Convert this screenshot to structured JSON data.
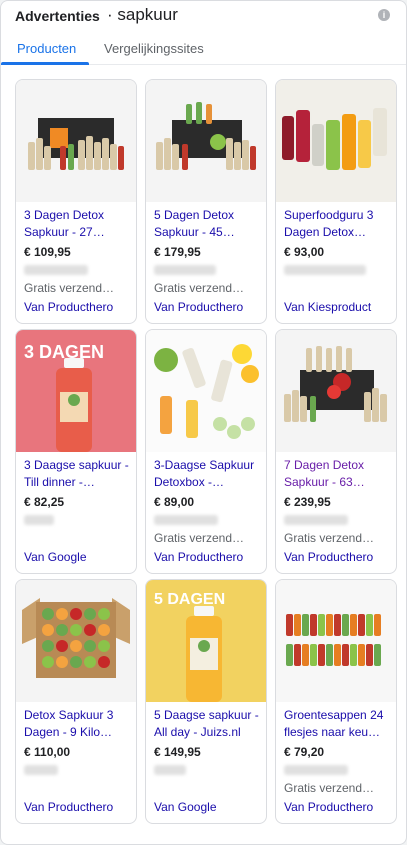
{
  "header": {
    "ads_label": "Advertenties",
    "query": "· sapkuur",
    "info_icon": "info-icon"
  },
  "tabs": [
    {
      "label": "Producten",
      "active": true
    },
    {
      "label": "Vergelijkingssites",
      "active": false
    }
  ],
  "products": [
    {
      "title": "3 Dagen Detox Sapkuur - 27…",
      "price": "€ 109,95",
      "shipping": "Gratis verzend…",
      "seller": "Van Producthero",
      "visited": false
    },
    {
      "title": "5 Dagen Detox Sapkuur - 45…",
      "price": "€ 179,95",
      "shipping": "Gratis verzend…",
      "seller": "Van Producthero",
      "visited": false
    },
    {
      "title": "Superfoodguru 3 Dagen Detox…",
      "price": "€ 93,00",
      "shipping": "",
      "seller": "Van Kiesproduct",
      "visited": false
    },
    {
      "title": "3 Daagse sapkuur - Till dinner -…",
      "price": "€ 82,25",
      "shipping": "",
      "seller": "Van Google",
      "visited": false
    },
    {
      "title": "3-Daagse Sapkuur Detoxbox -…",
      "price": "€ 89,00",
      "shipping": "Gratis verzend…",
      "seller": "Van Producthero",
      "visited": false
    },
    {
      "title": "7 Dagen Detox Sapkuur - 63…",
      "price": "€ 239,95",
      "shipping": "Gratis verzend…",
      "seller": "Van Producthero",
      "visited": true
    },
    {
      "title": "Detox Sapkuur 3 Dagen - 9 Kilo…",
      "price": "€ 110,00",
      "shipping": "",
      "seller": "Van Producthero",
      "visited": false
    },
    {
      "title": "5 Daagse sapkuur - All day - Juizs.nl",
      "price": "€ 149,95",
      "shipping": "",
      "seller": "Van Google",
      "visited": false
    },
    {
      "title": "Groentesappen 24 flesjes naar keu…",
      "price": "€ 79,20",
      "shipping": "Gratis verzend…",
      "seller": "Van Producthero",
      "visited": false
    }
  ],
  "image_texts": {
    "card4": "3 DAGEN",
    "card8": "5 DAGEN"
  },
  "colors": {
    "link": "#1a0dab",
    "visited": "#681da8",
    "accent": "#1a73e8",
    "card4_bg": "#e8757d",
    "card8_bg": "#f2d260"
  }
}
